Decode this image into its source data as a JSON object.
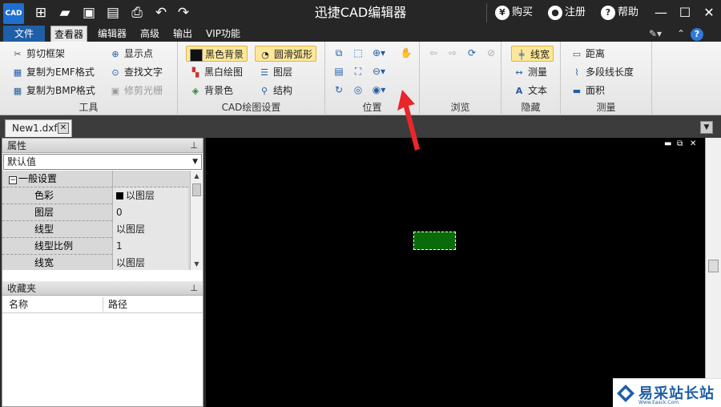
{
  "titlebar": {
    "logo": "CAD",
    "title": "迅捷CAD编辑器",
    "buy": "购买",
    "register": "注册",
    "help": "帮助"
  },
  "menubar": {
    "tabs": [
      "文件",
      "查看器",
      "编辑器",
      "高级",
      "输出",
      "VIP功能"
    ],
    "active_tab": "查看器"
  },
  "ribbon": {
    "tools": {
      "label": "工具",
      "items": [
        "剪切框架",
        "复制为EMF格式",
        "复制为BMP格式",
        "显示点",
        "查找文字",
        "修剪光栅"
      ]
    },
    "cad_settings": {
      "label": "CAD绘图设置",
      "items": [
        "黑色背景",
        "黑白绘图",
        "背景色",
        "圆滑弧形",
        "图层",
        "结构"
      ]
    },
    "position": {
      "label": "位置"
    },
    "browse": {
      "label": "浏览"
    },
    "hide": {
      "label": "隐藏",
      "items": [
        "线宽",
        "测量",
        "文本"
      ]
    },
    "measure": {
      "label": "测量",
      "items": [
        "距离",
        "多段线长度",
        "面积"
      ]
    }
  },
  "document": {
    "tab": "New1.dxf"
  },
  "properties": {
    "title": "属性",
    "select": "默认值",
    "category": "一般设置",
    "rows": [
      {
        "k": "色彩",
        "v": "以图层"
      },
      {
        "k": "图层",
        "v": "0"
      },
      {
        "k": "线型",
        "v": "以图层"
      },
      {
        "k": "线型比例",
        "v": "1"
      },
      {
        "k": "线宽",
        "v": "以图层"
      }
    ]
  },
  "favorites": {
    "title": "收藏夹",
    "col_name": "名称",
    "col_path": "路径"
  },
  "watermark": {
    "text": "易采站长站",
    "sub": "Www.Easck.Com"
  },
  "colors": {
    "canvas": "#000000",
    "rect_fill": "#0a6b0a",
    "accent": "#1f5fa8",
    "arrow": "#e8262b"
  }
}
